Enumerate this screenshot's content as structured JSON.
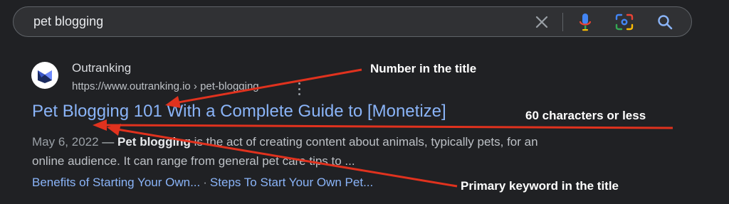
{
  "search": {
    "query": "pet blogging",
    "clear_icon": "close-icon",
    "voice_icon": "mic-icon",
    "lens_icon": "camera-lens-icon",
    "search_icon": "search-icon"
  },
  "result": {
    "site_name": "Outranking",
    "url": "https://www.outranking.io › pet-blogging",
    "favicon": "outranking-logo",
    "title": "Pet Blogging 101 With a Complete Guide to [Monetize]",
    "date": "May 6, 2022",
    "snippet_dash": " — ",
    "snippet_keyword": "Pet blogging",
    "snippet_line1_rest": " is the act of creating content about animals, typically pets, for an",
    "snippet_line2": "online audience. It can range from general pet care tips to ...",
    "sitelinks": [
      "Benefits of Starting Your Own...",
      "Steps To Start Your Own Pet..."
    ],
    "sitelink_separator": "·"
  },
  "annotations": {
    "number_in_title": "Number in the title",
    "char_limit": "60 characters or less",
    "primary_keyword": "Primary keyword in the title",
    "arrow_color": "#e0321e"
  }
}
